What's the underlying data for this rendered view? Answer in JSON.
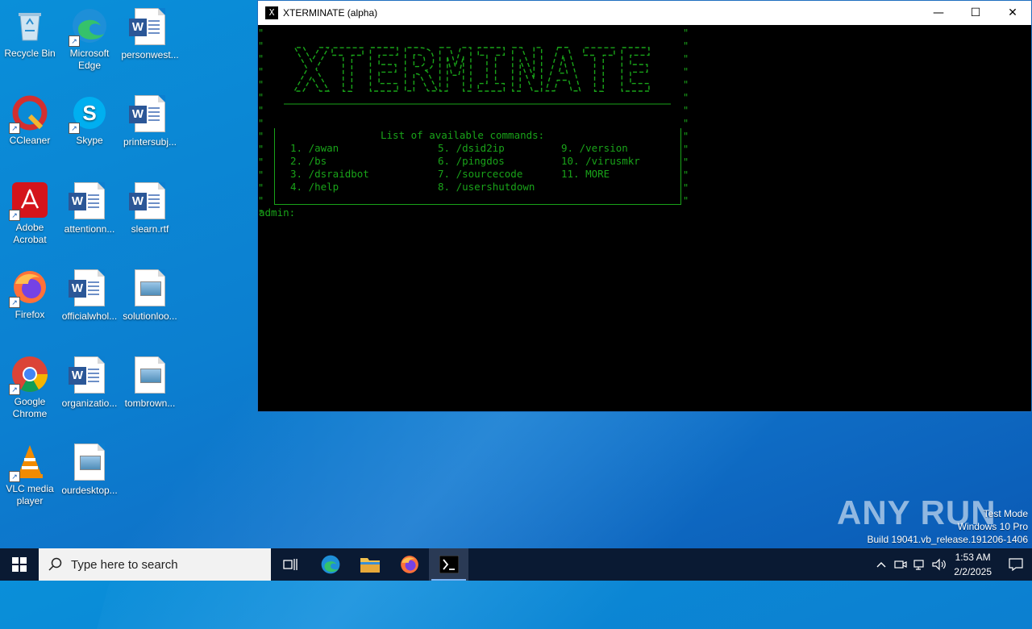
{
  "desktop": {
    "icons": [
      {
        "label": "Recycle Bin"
      },
      {
        "label": "Microsoft Edge"
      },
      {
        "label": "personwest..."
      },
      {
        "label": "CCleaner"
      },
      {
        "label": "Skype"
      },
      {
        "label": "printersubj..."
      },
      {
        "label": "Adobe Acrobat"
      },
      {
        "label": "attentionn..."
      },
      {
        "label": "slearn.rtf"
      },
      {
        "label": "Firefox"
      },
      {
        "label": "officialwhol..."
      },
      {
        "label": "solutionloo..."
      },
      {
        "label": "Google Chrome"
      },
      {
        "label": "organizatio..."
      },
      {
        "label": "tombrown..."
      },
      {
        "label": "VLC media player"
      },
      {
        "label": "ourdesktop..."
      }
    ]
  },
  "window": {
    "title": "XTERMINATE (alpha)",
    "icon_glyph": "X",
    "minimize_glyph": "—",
    "maximize_glyph": "☐",
    "close_glyph": "✕"
  },
  "terminal": {
    "banner_text": "XTERMINATE",
    "commands_title": "List of available commands:",
    "commands": [
      "1. /awan",
      "5. /dsid2ip",
      "9. /version",
      "2. /bs",
      "6. /pingdos",
      "10. /virusmkr",
      "3. /dsraidbot",
      "7. /sourcecode",
      "11. MORE",
      "4. /help",
      "8. /usershutdown"
    ],
    "prompt": "admin:"
  },
  "watermark": {
    "text": "ANY RUN"
  },
  "system_info": {
    "line1": "Test Mode",
    "line2": "Windows 10 Pro",
    "line3": "Build 19041.vb_release.191206-1406"
  },
  "taskbar": {
    "search_placeholder": "Type here to search",
    "time": "1:53 AM",
    "date": "2/2/2025"
  },
  "colors": {
    "terminal_green": "#19a319",
    "desktop_blue": "#0c7fd0",
    "taskbar": "#0a1a33"
  }
}
